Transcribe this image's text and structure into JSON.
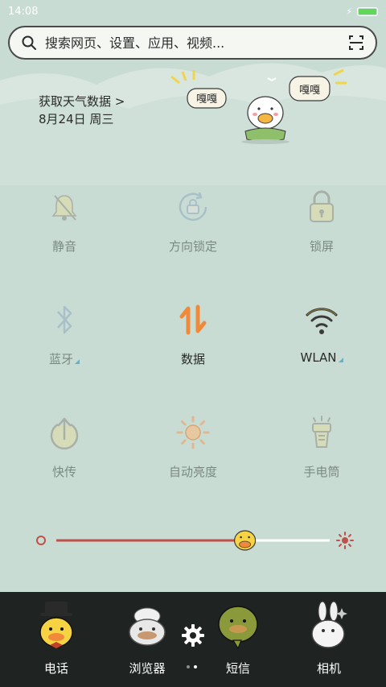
{
  "status_bar": {
    "time": "14:08",
    "battery_level": 1.0,
    "charging_icon": "lightning-icon"
  },
  "search": {
    "placeholder": "搜索网页、设置、应用、视频..."
  },
  "weather": {
    "link_text": "获取天气数据 >",
    "date": "8月24日 周三"
  },
  "mascot": {
    "bubble_left": "嘎嘎",
    "bubble_right": "嘎嘎"
  },
  "tiles": [
    {
      "label": "静音",
      "icon": "bell-muted-icon",
      "active": false
    },
    {
      "label": "方向锁定",
      "icon": "rotation-lock-icon",
      "active": false
    },
    {
      "label": "锁屏",
      "icon": "lock-icon",
      "active": false
    },
    {
      "label": "蓝牙",
      "icon": "bluetooth-icon",
      "active": false,
      "expandable": true
    },
    {
      "label": "数据",
      "icon": "mobile-data-icon",
      "active": true
    },
    {
      "label": "WLAN",
      "icon": "wifi-icon",
      "active": true,
      "expandable": true
    },
    {
      "label": "快传",
      "icon": "share-power-icon",
      "active": false
    },
    {
      "label": "自动亮度",
      "icon": "sun-icon",
      "active": false
    },
    {
      "label": "手电筒",
      "icon": "flashlight-icon",
      "active": false
    }
  ],
  "brightness": {
    "level": 0.69
  },
  "dock": {
    "apps": [
      {
        "label": "电话",
        "icon": "phone-duck-icon"
      },
      {
        "label": "浏览器",
        "icon": "browser-duck-icon"
      },
      {
        "label": "短信",
        "icon": "messages-duck-icon"
      },
      {
        "label": "相机",
        "icon": "camera-bunny-icon"
      }
    ],
    "page_count": 2,
    "current_page": 1
  },
  "colors": {
    "background": "#c9dcd4",
    "accent_orange": "#f08a3a",
    "slider_red": "#c0504a",
    "inactive_icon": "#a8b0a8",
    "wifi_active": "#3a3a3a",
    "dock_bg": "#1f2422"
  }
}
